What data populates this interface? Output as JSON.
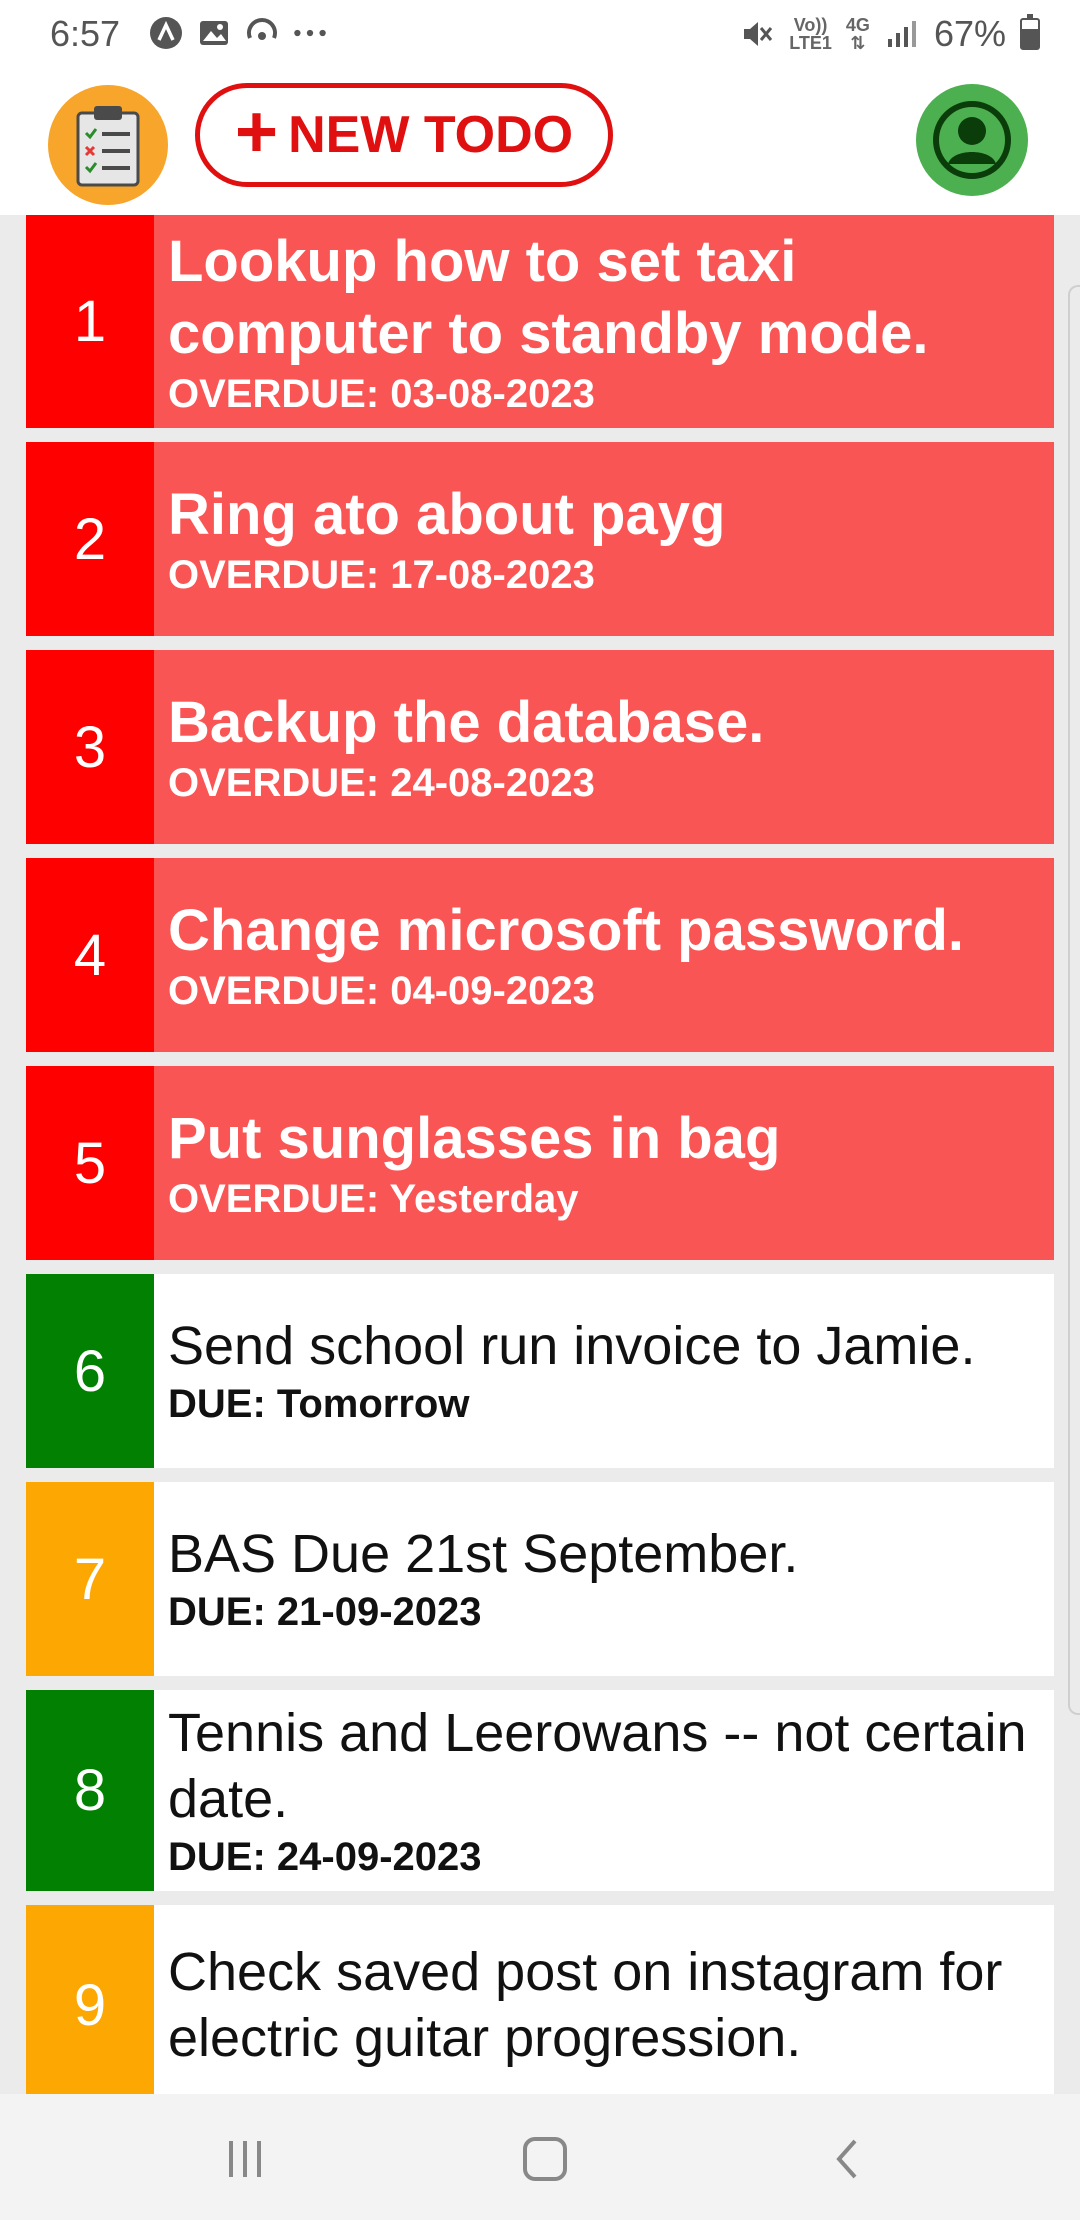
{
  "status_bar": {
    "time": "6:57",
    "lte_top": "Vo))",
    "lte_bottom": "LTE1",
    "net": "4G",
    "battery_text": "67%",
    "battery_level": 0.67
  },
  "header": {
    "logo_icon": "checklist-icon",
    "new_button_plus": "+",
    "new_button_label": "NEW TODO",
    "profile_icon": "user-icon"
  },
  "todos": [
    {
      "num": "1",
      "title": "Lookup how to set taxi computer to standby mode.",
      "due": "OVERDUE: 03-08-2023",
      "status": "overdue",
      "color": "#fe0000"
    },
    {
      "num": "2",
      "title": "Ring ato about payg",
      "due": "OVERDUE: 17-08-2023",
      "status": "overdue",
      "color": "#fe0000"
    },
    {
      "num": "3",
      "title": "Backup the database.",
      "due": "OVERDUE: 24-08-2023",
      "status": "overdue",
      "color": "#fe0000"
    },
    {
      "num": "4",
      "title": "Change microsoft password.",
      "due": "OVERDUE: 04-09-2023",
      "status": "overdue",
      "color": "#fe0000"
    },
    {
      "num": "5",
      "title": "Put sunglasses in bag",
      "due": "OVERDUE: Yesterday",
      "status": "overdue",
      "color": "#fe0000"
    },
    {
      "num": "6",
      "title": "Send school run invoice to Jamie.",
      "due": "DUE: Tomorrow",
      "status": "normal",
      "color": "#028002"
    },
    {
      "num": "7",
      "title": "BAS Due 21st September.",
      "due": "DUE: 21-09-2023",
      "status": "normal",
      "color": "#fca702"
    },
    {
      "num": "8",
      "title": "Tennis and Leerowans -- not certain date.",
      "due": "DUE: 24-09-2023",
      "status": "normal",
      "color": "#028002"
    },
    {
      "num": "9",
      "title": "Check saved post on instagram for electric guitar progression.",
      "due": "",
      "status": "normal",
      "color": "#fca702"
    }
  ],
  "nav": {
    "recents_icon": "recents-icon",
    "home_icon": "home-icon",
    "back_icon": "back-icon"
  }
}
